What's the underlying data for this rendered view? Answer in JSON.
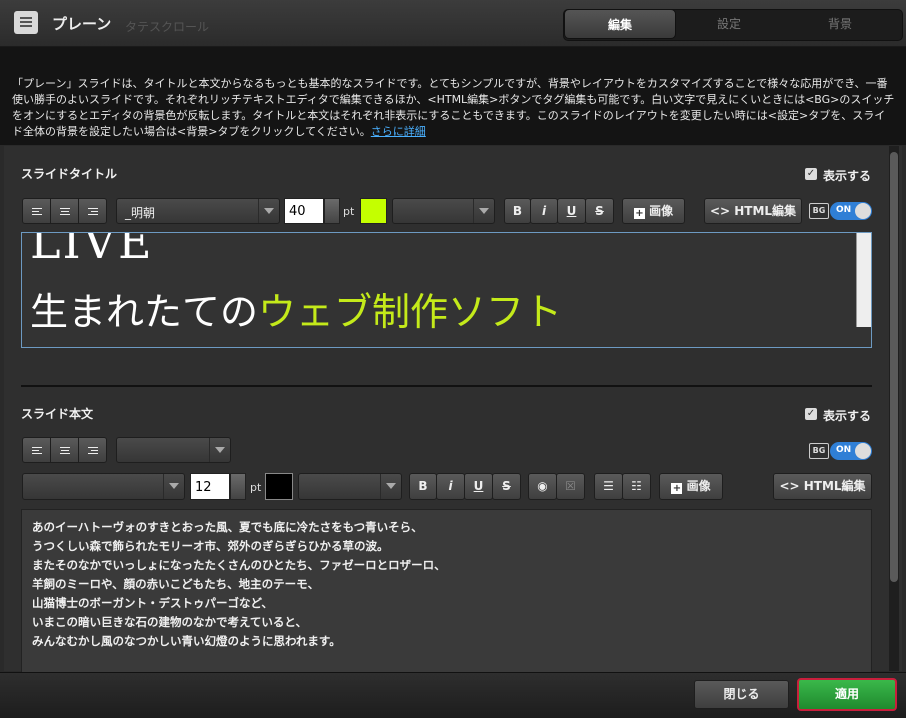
{
  "header": {
    "title": "プレーン",
    "ghost_text": "タテスクロール",
    "tabs": [
      "編集",
      "設定",
      "背景"
    ]
  },
  "description": {
    "text": "「プレーン」スライドは、タイトルと本文からなるもっとも基本的なスライドです。とてもシンプルですが、背景やレイアウトをカスタマイズすることで様々な応用ができ、一番使い勝手のよいスライドです。それぞれリッチテキストエディタで編集できるほか、<HTML編集>ボタンでタグ編集も可能です。白い文字で見えにくいときには<BG>のスイッチをオンにするとエディタの背景色が反転します。タイトルと本文はそれぞれ非表示にすることもできます。このスライドのレイアウトを変更したい時には<設定>タブを、スライド全体の背景を設定したい場合は<背景>タブをクリックしてください。",
    "link": "さらに詳細"
  },
  "title_section": {
    "label": "スライドタイトル",
    "show_label": "表示する",
    "show_checked": true,
    "font": "_明朝",
    "size": "40",
    "unit": "pt",
    "color": "#c4ff00",
    "image_label": "画像",
    "html_edit_label": "HTML編集",
    "bg_label": "BG",
    "toggle_label": "ON",
    "editor_line1": "LIVE",
    "editor_line2_plain": "生まれたての",
    "editor_line2_highlight": "ウェブ制作ソフト",
    "path": [
      "body",
      "div",
      "span",
      "span",
      "span",
      "span"
    ]
  },
  "body_section": {
    "label": "スライド本文",
    "show_label": "表示する",
    "show_checked": true,
    "size": "12",
    "unit": "pt",
    "color": "#000000",
    "image_label": "画像",
    "html_edit_label": "HTML編集",
    "bg_label": "BG",
    "toggle_label": "ON",
    "lines": [
      "あのイーハトーヴォのすきとおった風、夏でも底に冷たさをもつ青いそら、",
      "うつくしい森で飾られたモリーオ市、郊外のぎらぎらひかる草の波。",
      "またそのなかでいっしょになったたくさんのひとたち、ファゼーロとロザーロ、",
      "羊飼のミーロや、顔の赤いこどもたち、地主のテーモ、",
      "山猫博士のボーガント・デストゥパーゴなど、",
      "いまこの暗い巨きな石の建物のなかで考えていると、",
      "みんなむかし風のなつかしい青い幻燈のように思われます。"
    ]
  },
  "footer": {
    "close_label": "閉じる",
    "apply_label": "適用"
  },
  "colors": {
    "accent": "#2f7fd6",
    "apply": "#2a9e3a",
    "highlight": "#c4ea1a"
  }
}
